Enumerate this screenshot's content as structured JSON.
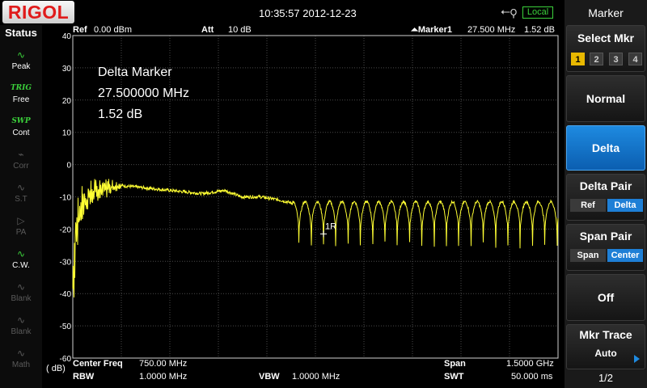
{
  "brand": "RIGOL",
  "datetime": "10:35:57 2012-12-23",
  "usb_icon": "usb-icon",
  "local_label": "Local",
  "status": {
    "title": "Status",
    "items": [
      {
        "glyph": "∿",
        "label": "Peak",
        "active": true
      },
      {
        "glyph": "TRIG",
        "label": "Free",
        "active": true
      },
      {
        "glyph": "SWP",
        "label": "Cont",
        "active": true
      },
      {
        "glyph": "⌁",
        "label": "Corr",
        "active": false
      },
      {
        "glyph": "∿",
        "label": "S.T",
        "active": false
      },
      {
        "glyph": "▷",
        "label": "PA",
        "active": false
      },
      {
        "glyph": "∿",
        "label": "C.W.",
        "active": true
      },
      {
        "glyph": "∿",
        "label": "Blank",
        "active": false
      },
      {
        "glyph": "∿",
        "label": "Blank",
        "active": false
      },
      {
        "glyph": "∿",
        "label": "Math",
        "active": false
      }
    ]
  },
  "header": {
    "ref_label": "Ref",
    "ref_value": "0.00 dBm",
    "att_label": "Att",
    "att_value": "10 dB",
    "marker_label": "Marker1",
    "marker_freq": "27.500 MHz",
    "marker_level": "1.52 dB"
  },
  "readout": {
    "line1": "Delta Marker",
    "line2": "27.500000 MHz",
    "line3": "1.52 dB"
  },
  "y_axis": {
    "ticks": [
      "40",
      "30",
      "20",
      "10",
      "0",
      "-10",
      "-20",
      "-30",
      "-40",
      "-50",
      "-60"
    ],
    "unit": "( dB)"
  },
  "footer": {
    "center_label": "Center Freq",
    "center_value": "750.00 MHz",
    "span_label": "Span",
    "span_value": "1.5000 GHz",
    "rbw_label": "RBW",
    "rbw_value": "1.0000 MHz",
    "vbw_label": "VBW",
    "vbw_value": "1.0000 MHz",
    "swt_label": "SWT",
    "swt_value": "50.000 ms"
  },
  "marker_tag": "1R",
  "menu": {
    "title": "Marker",
    "select_mkr": {
      "label": "Select Mkr",
      "numbers": [
        "1",
        "2",
        "3",
        "4"
      ],
      "selected": 0
    },
    "normal": "Normal",
    "delta": "Delta",
    "delta_pair": {
      "label": "Delta Pair",
      "opt1": "Ref",
      "opt2": "Delta"
    },
    "span_pair": {
      "label": "Span Pair",
      "opt1": "Span",
      "opt2": "Center"
    },
    "off": "Off",
    "mkr_trace": {
      "label": "Mkr Trace",
      "value": "Auto"
    },
    "page": "1/2"
  },
  "chart_data": {
    "type": "line",
    "x_start_mhz": 0,
    "x_end_mhz": 1500,
    "ylim": [
      -60,
      40
    ],
    "grid": true,
    "trace_color": "#ffff33",
    "series": [
      {
        "points": [
          [
            0,
            -30
          ],
          [
            10,
            -18
          ],
          [
            20,
            -14
          ],
          [
            40,
            -11
          ],
          [
            60,
            -9
          ],
          [
            80,
            -8
          ],
          [
            100,
            -7
          ],
          [
            150,
            -6.5
          ],
          [
            200,
            -7
          ],
          [
            300,
            -8
          ],
          [
            400,
            -9
          ],
          [
            470,
            -8
          ],
          [
            520,
            -10
          ],
          [
            580,
            -10
          ],
          [
            640,
            -11
          ],
          [
            680,
            -12
          ],
          [
            700,
            -12
          ],
          [
            1500,
            -12
          ]
        ]
      }
    ],
    "ripple_start_mhz": 680,
    "ripple_period_mhz": 38,
    "ripple_top_db": -11.5,
    "ripple_bottom_db": -21,
    "ripple_dip_db": -26,
    "marker": {
      "x_mhz": 775,
      "y_db": -21.5
    }
  },
  "colors": {
    "grid": "#4a4a4a",
    "frame": "#cfcfcf",
    "accent": "#1e8ae0",
    "local_green": "#3bd13b",
    "marker_yellow": "#e8b800"
  }
}
